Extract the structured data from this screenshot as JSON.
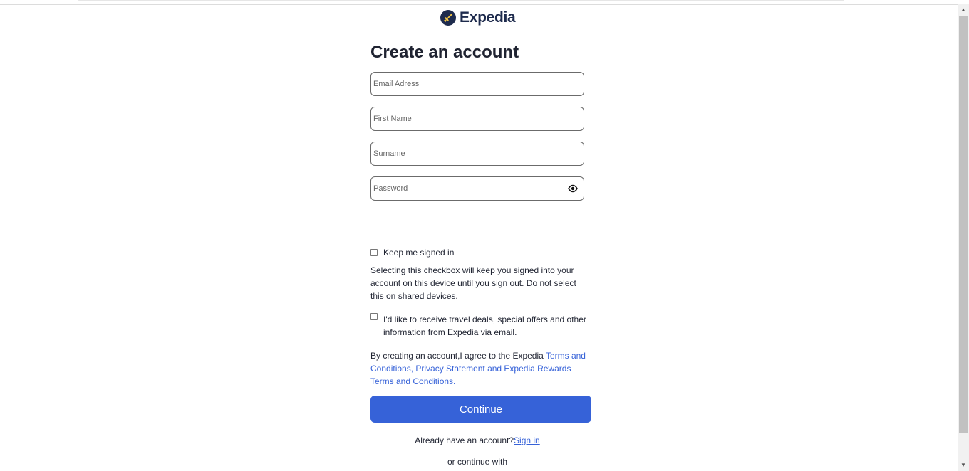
{
  "brand": {
    "name": "Expedia",
    "logo_icon": "plane-icon",
    "color": "#1e2b4d"
  },
  "form": {
    "title": "Create an account",
    "email": {
      "placeholder": "Email Adress",
      "value": ""
    },
    "first_name": {
      "placeholder": "First Name",
      "value": ""
    },
    "surname": {
      "placeholder": "Surname",
      "value": ""
    },
    "password": {
      "placeholder": "Password",
      "value": "",
      "toggle_icon": "eye-icon"
    },
    "keep_signed_in": {
      "label": "Keep me signed in",
      "checked": false,
      "help": "Selecting this checkbox will keep you signed into your account on this device until you sign out. Do not select this on shared devices."
    },
    "travel_deals": {
      "label": "I'd like to receive travel deals, special offers and other information from Expedia via email.",
      "checked": false
    },
    "terms": {
      "prefix": "By creating an account,I agree to the Expedia ",
      "link_text": "Terms and Conditions, Privacy Statement and Expedia Rewards Terms and Conditions."
    },
    "continue_label": "Continue",
    "already_text": "Already have an account?",
    "signin_link": "Sign in",
    "continue_with": "or continue with"
  },
  "colors": {
    "accent": "#3662d8",
    "text": "#1f2331"
  }
}
